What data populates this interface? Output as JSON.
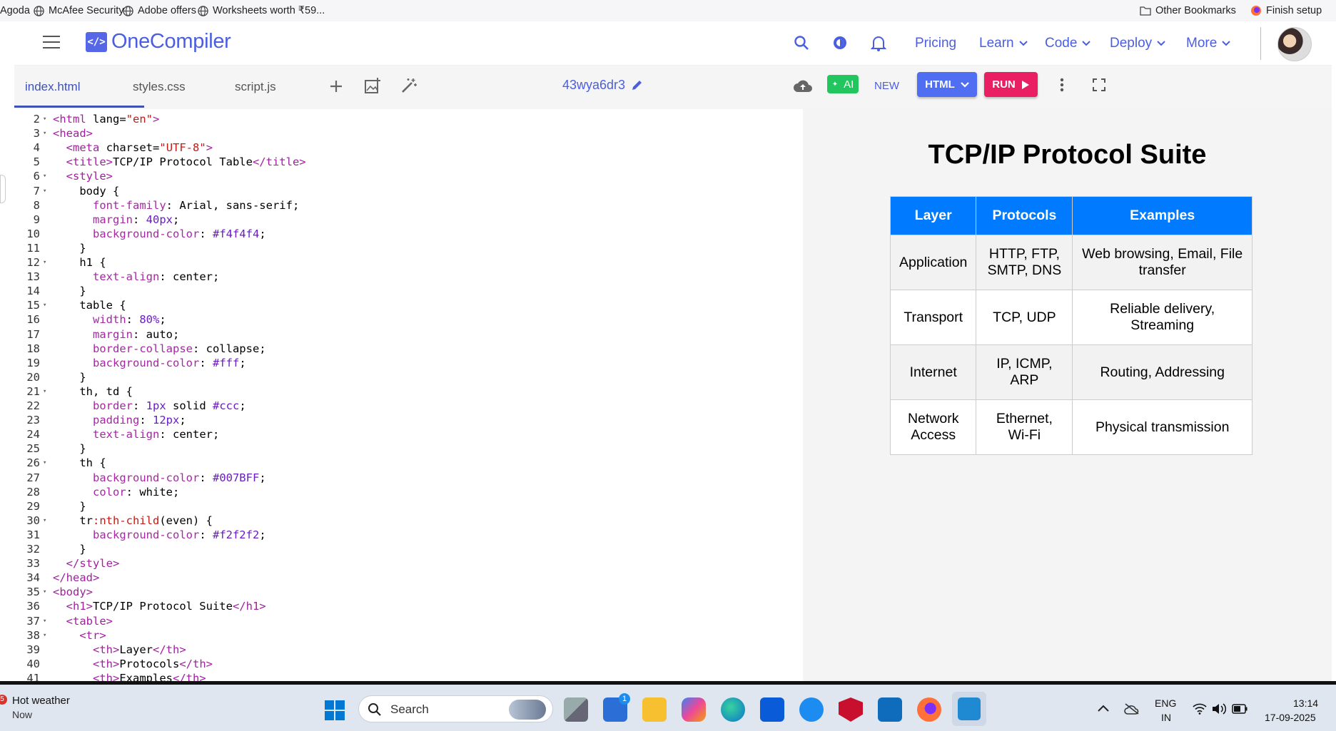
{
  "bookmarks": {
    "items": [
      "Agoda",
      "McAfee Security",
      "Adobe offers",
      "Worksheets worth ₹59..."
    ],
    "other": "Other Bookmarks",
    "finish": "Finish setup"
  },
  "header": {
    "logo": "OneCompiler",
    "logo_mark": "</>",
    "nav": [
      "Pricing",
      "Learn",
      "Code",
      "Deploy",
      "More"
    ]
  },
  "toolbar": {
    "tabs": [
      "index.html",
      "styles.css",
      "script.js"
    ],
    "code_id": "43wya6dr3",
    "ai_label": "AI",
    "new_label": "NEW",
    "lang_label": "HTML",
    "run_label": "RUN"
  },
  "editor": {
    "lines": [
      {
        "n": 2,
        "f": true,
        "html": "<span class='t'>&lt;html</span> <span class='a'>lang</span>=<span class='v'>\"en\"</span><span class='t'>&gt;</span>"
      },
      {
        "n": 3,
        "f": true,
        "html": "<span class='t'>&lt;head&gt;</span>"
      },
      {
        "n": 4,
        "f": false,
        "html": "  <span class='t'>&lt;meta</span> <span class='a'>charset</span>=<span class='v'>\"UTF-8\"</span><span class='t'>&gt;</span>"
      },
      {
        "n": 5,
        "f": false,
        "html": "  <span class='t'>&lt;title&gt;</span>TCP/IP Protocol Table<span class='t'>&lt;/title&gt;</span>"
      },
      {
        "n": 6,
        "f": true,
        "html": "  <span class='t'>&lt;style&gt;</span>"
      },
      {
        "n": 7,
        "f": true,
        "html": "    body {"
      },
      {
        "n": 8,
        "f": false,
        "html": "      <span class='p'>font-family</span>: Arial, sans-serif;"
      },
      {
        "n": 9,
        "f": false,
        "html": "      <span class='p'>margin</span>: <span class='n'>40px</span>;"
      },
      {
        "n": 10,
        "f": false,
        "html": "      <span class='p'>background-color</span>: <span class='n'>#f4f4f4</span>;"
      },
      {
        "n": 11,
        "f": false,
        "html": "    }"
      },
      {
        "n": 12,
        "f": true,
        "html": "    h1 {"
      },
      {
        "n": 13,
        "f": false,
        "html": "      <span class='p'>text-align</span>: center;"
      },
      {
        "n": 14,
        "f": false,
        "html": "    }"
      },
      {
        "n": 15,
        "f": true,
        "html": "    table {"
      },
      {
        "n": 16,
        "f": false,
        "html": "      <span class='p'>width</span>: <span class='n'>80%</span>;"
      },
      {
        "n": 17,
        "f": false,
        "html": "      <span class='p'>margin</span>: auto;"
      },
      {
        "n": 18,
        "f": false,
        "html": "      <span class='p'>border-collapse</span>: collapse;"
      },
      {
        "n": 19,
        "f": false,
        "html": "      <span class='p'>background-color</span>: <span class='n'>#fff</span>;"
      },
      {
        "n": 20,
        "f": false,
        "html": "    }"
      },
      {
        "n": 21,
        "f": true,
        "html": "    th, td {"
      },
      {
        "n": 22,
        "f": false,
        "html": "      <span class='p'>border</span>: <span class='n'>1px</span> solid <span class='n'>#ccc</span>;"
      },
      {
        "n": 23,
        "f": false,
        "html": "      <span class='p'>padding</span>: <span class='n'>12px</span>;"
      },
      {
        "n": 24,
        "f": false,
        "html": "      <span class='p'>text-align</span>: center;"
      },
      {
        "n": 25,
        "f": false,
        "html": "    }"
      },
      {
        "n": 26,
        "f": true,
        "html": "    th {"
      },
      {
        "n": 27,
        "f": false,
        "html": "      <span class='p'>background-color</span>: <span class='n'>#007BFF</span>;"
      },
      {
        "n": 28,
        "f": false,
        "html": "      <span class='p'>color</span>: white;"
      },
      {
        "n": 29,
        "f": false,
        "html": "    }"
      },
      {
        "n": 30,
        "f": true,
        "html": "    tr<span class='v'>:nth-child</span>(even) {"
      },
      {
        "n": 31,
        "f": false,
        "html": "      <span class='p'>background-color</span>: <span class='n'>#f2f2f2</span>;"
      },
      {
        "n": 32,
        "f": false,
        "html": "    }"
      },
      {
        "n": 33,
        "f": false,
        "html": "  <span class='t'>&lt;/style&gt;</span>"
      },
      {
        "n": 34,
        "f": false,
        "html": "<span class='t'>&lt;/head&gt;</span>"
      },
      {
        "n": 35,
        "f": true,
        "html": "<span class='t'>&lt;body&gt;</span>"
      },
      {
        "n": 36,
        "f": false,
        "html": "  <span class='t'>&lt;h1&gt;</span>TCP/IP Protocol Suite<span class='t'>&lt;/h1&gt;</span>"
      },
      {
        "n": 37,
        "f": true,
        "html": "  <span class='t'>&lt;table&gt;</span>"
      },
      {
        "n": 38,
        "f": true,
        "html": "    <span class='t'>&lt;tr&gt;</span>"
      },
      {
        "n": 39,
        "f": false,
        "html": "      <span class='t'>&lt;th&gt;</span>Layer<span class='t'>&lt;/th&gt;</span>"
      },
      {
        "n": 40,
        "f": false,
        "html": "      <span class='t'>&lt;th&gt;</span>Protocols<span class='t'>&lt;/th&gt;</span>"
      },
      {
        "n": 41,
        "f": false,
        "html": "      <span class='t'>&lt;th&gt;</span>Examples<span class='t'>&lt;/th&gt;</span>"
      }
    ]
  },
  "preview": {
    "title": "TCP/IP Protocol Suite",
    "headers": [
      "Layer",
      "Protocols",
      "Examples"
    ],
    "rows": [
      [
        "Application",
        "HTTP, FTP, SMTP, DNS",
        "Web browsing, Email, File transfer"
      ],
      [
        "Transport",
        "TCP, UDP",
        "Reliable delivery, Streaming"
      ],
      [
        "Internet",
        "IP, ICMP, ARP",
        "Routing, Addressing"
      ],
      [
        "Network Access",
        "Ethernet, Wi-Fi",
        "Physical transmission"
      ]
    ]
  },
  "taskbar": {
    "weather_title": "Hot weather",
    "weather_sub": "Now",
    "weather_badge": "5",
    "search_placeholder": "Search",
    "store_badge": "1",
    "lang": "ENG",
    "region": "IN",
    "time": "13:14",
    "date": "17-09-2025"
  },
  "colors": {
    "accent": "#4b5ee0",
    "run": "#e91e63",
    "ai": "#22c55e",
    "th": "#007BFF"
  }
}
